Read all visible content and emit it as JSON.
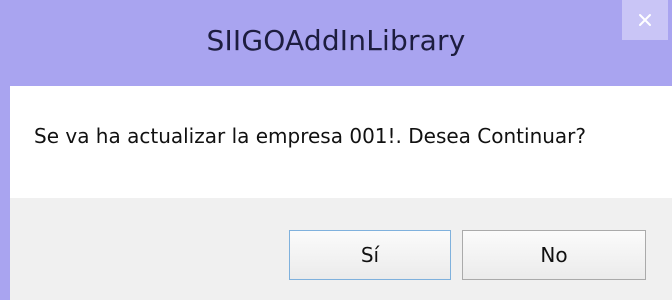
{
  "window": {
    "title": "SIIGOAddInLibrary"
  },
  "message": {
    "text": "Se va ha actualizar la empresa 001!. Desea Continuar?"
  },
  "buttons": {
    "yes": "Sí",
    "no": "No"
  },
  "icons": {
    "close": "close-icon"
  },
  "colors": {
    "titlebar": "#a9a4f0",
    "close_button": "#c9c5f6",
    "content_bg": "#ffffff",
    "footer_bg": "#f0f0f0"
  }
}
